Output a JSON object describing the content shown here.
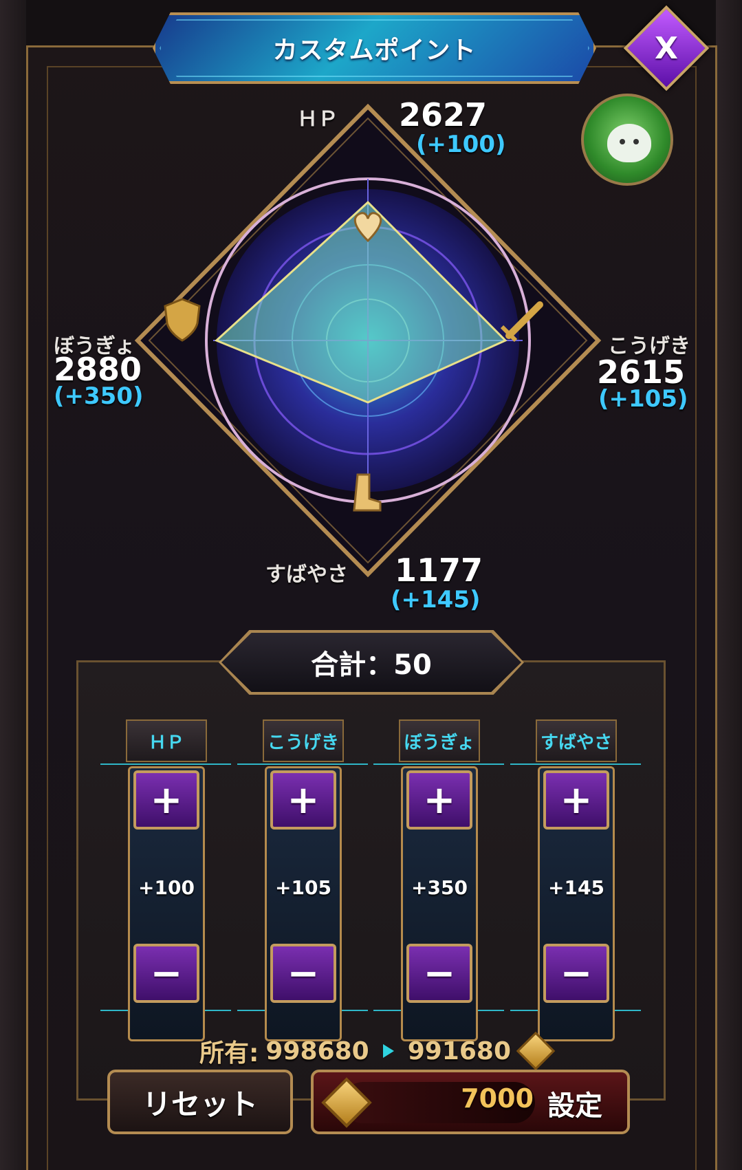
{
  "title": "カスタムポイント",
  "close_label": "X",
  "stats": {
    "hp": {
      "name": "ＨＰ",
      "value": "2627",
      "bonus": "(+100)"
    },
    "attack": {
      "name": "こうげき",
      "value": "2615",
      "bonus": "(+105)"
    },
    "defense": {
      "name": "ぼうぎょ",
      "value": "2880",
      "bonus": "(+350)"
    },
    "speed": {
      "name": "すばやさ",
      "value": "1177",
      "bonus": "(+145)"
    }
  },
  "total_text": "合計：50",
  "columns": [
    {
      "label": "ＨＰ",
      "plus": "+",
      "minus": "−",
      "bonus": "+100",
      "fill": 0.07
    },
    {
      "label": "こうげき",
      "plus": "+",
      "minus": "−",
      "bonus": "+105",
      "fill": 0.07
    },
    {
      "label": "ぼうぎょ",
      "plus": "+",
      "minus": "−",
      "bonus": "+350",
      "fill": 0.2
    },
    {
      "label": "すばやさ",
      "plus": "+",
      "minus": "−",
      "bonus": "+145",
      "fill": 0.09
    }
  ],
  "owned": {
    "label": "所有:",
    "current": "998680",
    "after": "991680"
  },
  "reset_label": "リセット",
  "set": {
    "cost": "7000",
    "label": "設定"
  },
  "colors": {
    "accent": "#3ec9ff",
    "gold": "#b58b4d",
    "purple": "#7a2fb0"
  }
}
